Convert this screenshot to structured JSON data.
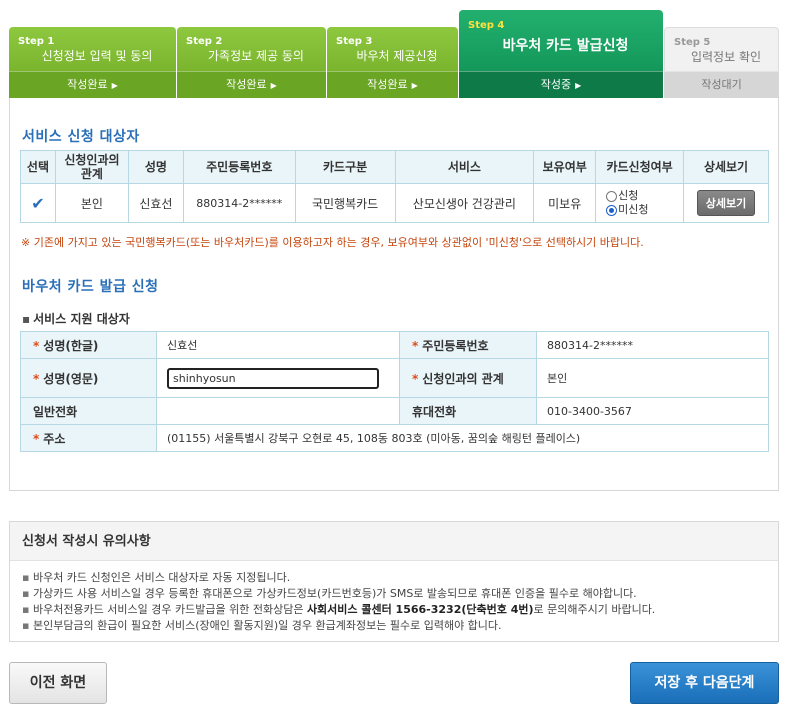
{
  "steps": [
    {
      "num": "Step 1",
      "name": "신청정보 입력 및 동의",
      "status": "작성완료"
    },
    {
      "num": "Step 2",
      "name": "가족정보 제공 동의",
      "status": "작성완료"
    },
    {
      "num": "Step 3",
      "name": "바우처 제공신청",
      "status": "작성완료"
    },
    {
      "num": "Step 4",
      "name": "바우처 카드 발급신청",
      "status": "작성중"
    },
    {
      "num": "Step 5",
      "name": "입력정보 확인",
      "status": "작성대기"
    }
  ],
  "target": {
    "title": "서비스 신청 대상자",
    "headers": [
      "선택",
      "신청인과의 관계",
      "성명",
      "주민등록번호",
      "카드구분",
      "서비스",
      "보유여부",
      "카드신청여부",
      "상세보기"
    ],
    "row": {
      "relation": "본인",
      "name": "신효선",
      "rrn": "880314-2******",
      "card_type": "국민행복카드",
      "service": "산모신생아 건강관리",
      "owned": "미보유",
      "opt_apply": "신청",
      "opt_not_apply": "미신청",
      "selected_option": "미신청",
      "detail_button": "상세보기"
    },
    "notice": "※ 기존에 가지고 있는 국민행복카드(또는 바우처카드)를 이용하고자 하는 경우, 보유여부와 상관없이 '미신청'으로 선택하시기 바랍니다."
  },
  "issue": {
    "title": "바우처 카드 발급 신청",
    "subtitle": "서비스 지원 대상자",
    "name_kr_label": "성명(한글)",
    "name_kr": "신효선",
    "rrn_label": "주민등록번호",
    "rrn": "880314-2******",
    "name_en_label": "성명(영문)",
    "name_en": "shinhyosun",
    "relation_label": "신청인과의 관계",
    "relation": "본인",
    "phone_label": "일반전화",
    "phone": "",
    "mobile_label": "휴대전화",
    "mobile": "010-3400-3567",
    "address_label": "주소",
    "address": "(01155) 서울특별시 강북구 오현로 45, 108동 803호 (미아동, 꿈의숲 해링턴 플레이스)"
  },
  "notes": {
    "title": "신청서 작성시 유의사항",
    "items": [
      {
        "text": "바우처 카드 신청인은 서비스 대상자로 자동 지정됩니다."
      },
      {
        "text": "가상카드 사용 서비스일 경우 등록한 휴대폰으로 가상카드정보(카드번호등)가 SMS로 발송되므로 휴대폰 인증을 필수로 해야합니다."
      },
      {
        "pre": "바우처전용카드 서비스일 경우 카드발급을 위한 전화상담은 ",
        "bold": "사회서비스 콜센터 1566-3232(단축번호 4번)",
        "post": "로 문의해주시기 바랍니다."
      },
      {
        "text": "본인부담금의 환급이 필요한 서비스(장애인 활동지원)일 경우 환급계좌정보는 필수로 입력해야 합니다."
      }
    ]
  },
  "buttons": {
    "prev": "이전 화면",
    "next": "저장 후 다음단계"
  },
  "colors": {
    "step_done": "#7bb52e",
    "step_current": "#13985a",
    "accent_blue": "#2a6fb7",
    "notice": "#c4450c"
  }
}
